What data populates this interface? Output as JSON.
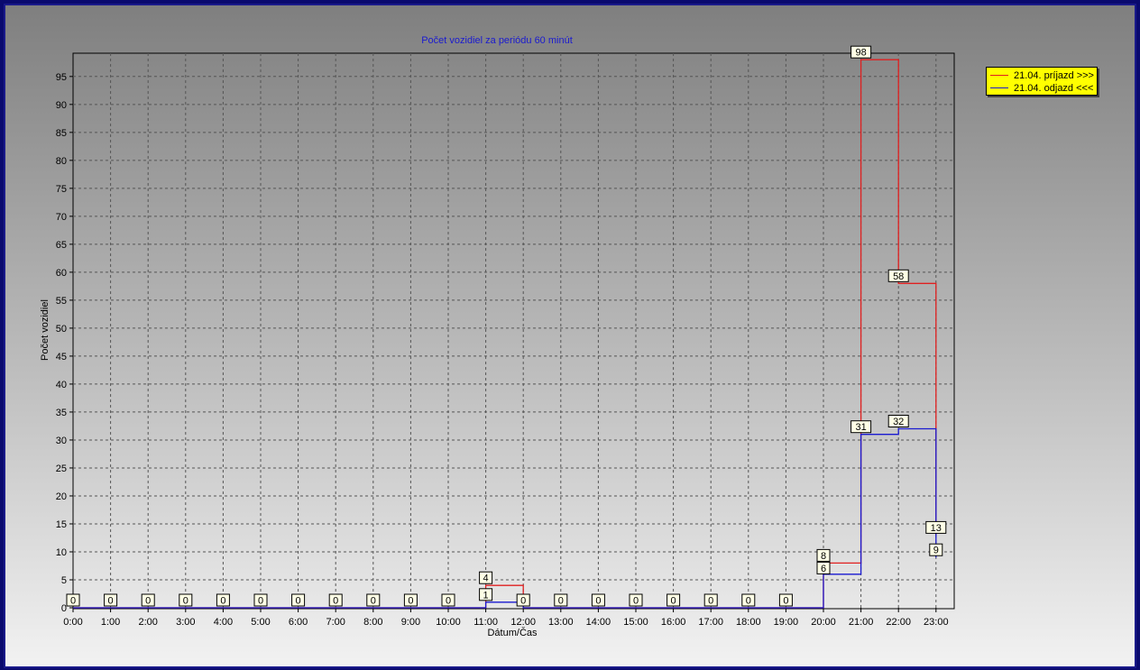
{
  "chart_data": {
    "type": "line",
    "step": true,
    "title": "Počet vozidiel za periódu 60 minút",
    "xlabel": "Dátum/Čas",
    "ylabel": "Počet vozidiel",
    "categories": [
      "0:00",
      "1:00",
      "2:00",
      "3:00",
      "4:00",
      "5:00",
      "6:00",
      "7:00",
      "8:00",
      "9:00",
      "10:00",
      "11:00",
      "12:00",
      "13:00",
      "14:00",
      "15:00",
      "16:00",
      "17:00",
      "18:00",
      "19:00",
      "20:00",
      "21:00",
      "22:00",
      "23:00"
    ],
    "ylim": [
      0,
      99
    ],
    "yticks": [
      0,
      5,
      10,
      15,
      20,
      25,
      30,
      35,
      40,
      45,
      50,
      55,
      60,
      65,
      70,
      75,
      80,
      85,
      90,
      95
    ],
    "grid": true,
    "legend_position": "top-right",
    "series": [
      {
        "name": "21.04. príjazd >>>",
        "color": "#e02020",
        "values": [
          0,
          0,
          0,
          0,
          0,
          0,
          0,
          0,
          0,
          0,
          0,
          4,
          0,
          0,
          0,
          0,
          0,
          0,
          0,
          0,
          8,
          98,
          58,
          13
        ]
      },
      {
        "name": "21.04. odjazd <<<",
        "color": "#1a1ad0",
        "values": [
          0,
          0,
          0,
          0,
          0,
          0,
          0,
          0,
          0,
          0,
          0,
          1,
          0,
          0,
          0,
          0,
          0,
          0,
          0,
          0,
          6,
          31,
          32,
          9
        ]
      }
    ]
  },
  "legend": {
    "items": [
      {
        "label": "21.04. príjazd >>>",
        "color": "#e02020"
      },
      {
        "label": "21.04. odjazd <<<",
        "color": "#1a1ad0"
      }
    ]
  }
}
